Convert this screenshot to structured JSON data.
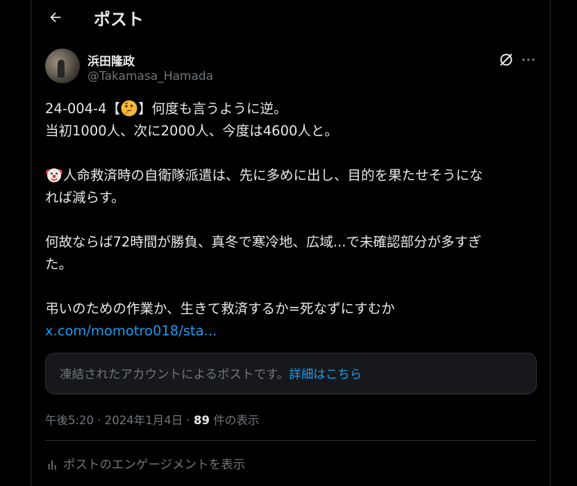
{
  "header": {
    "title": "ポスト"
  },
  "author": {
    "name": "浜田隆政",
    "handle": "@Takamasa_Hamada"
  },
  "tweet": {
    "line1_prefix": "24-004-4【",
    "line1_suffix": "】何度も言うように逆。",
    "line2": "当初1000人、次に2000人、今度は4600人と。",
    "line3": "人命救済時の自衛隊派遣は、先に多めに出し、目的を果たせそうにな",
    "line4": "れば減らす。",
    "line5": "何故ならば72時間が勝負、真冬で寒冷地、広域...で未確認部分が多すぎ",
    "line6": "た。",
    "line7": "弔いのための作業か、生きて救済するか=死なずにすむか",
    "link": "x.com/momotro018/sta..."
  },
  "notice": {
    "text": "凍結されたアカウントによるポストです。",
    "link": "詳細はこちら"
  },
  "meta": {
    "time": "午後5:20 · 2024年1月4日 · ",
    "views": "89",
    "views_label": " 件の表示"
  },
  "engagement": {
    "label": "ポストのエンゲージメントを表示"
  },
  "icons": {
    "back": "arrow-left-icon",
    "grok": "grok-icon",
    "more": "more-icon",
    "emoji1": "thinking-face-emoji",
    "emoji2": "clown-face-emoji",
    "analytics": "analytics-icon"
  },
  "colors": {
    "link": "#1d9bf0",
    "secondary": "#71767b",
    "text": "#e7e9ea",
    "background": "#000000"
  }
}
